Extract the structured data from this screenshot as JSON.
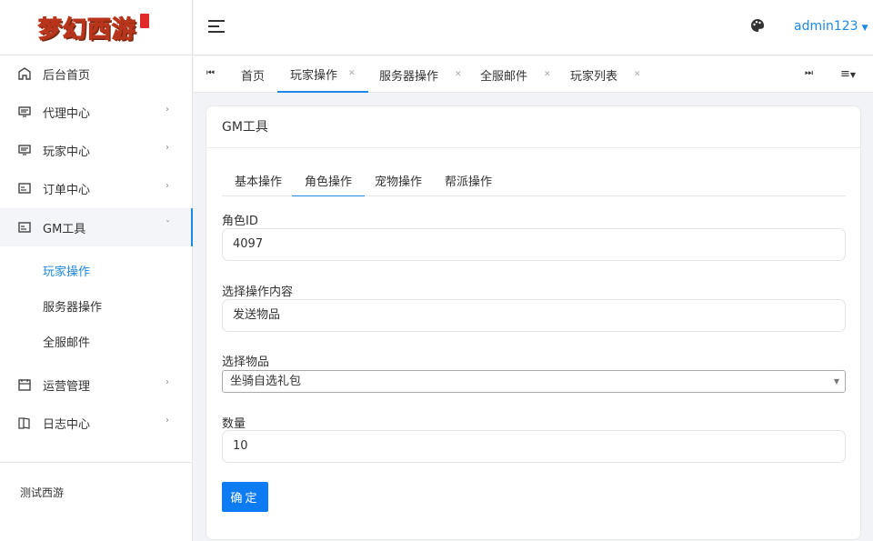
{
  "logo": {
    "text": "梦幻西游"
  },
  "sidebar": {
    "items": [
      {
        "label": "后台首页",
        "icon": "home-icon"
      },
      {
        "label": "代理中心",
        "icon": "monitor-icon"
      },
      {
        "label": "玩家中心",
        "icon": "monitor-icon"
      },
      {
        "label": "订单中心",
        "icon": "card-icon"
      },
      {
        "label": "GM工具",
        "icon": "card-icon"
      },
      {
        "label": "运营管理",
        "icon": "calendar-icon"
      },
      {
        "label": "日志中心",
        "icon": "book-icon"
      }
    ],
    "sub_items": [
      {
        "label": "玩家操作"
      },
      {
        "label": "服务器操作"
      },
      {
        "label": "全服邮件"
      }
    ],
    "footer": "测试西游"
  },
  "header": {
    "user": "admin123",
    "icons": [
      "menu-icon",
      "palette-icon"
    ]
  },
  "tabs": [
    {
      "label": "首页"
    },
    {
      "label": "玩家操作"
    },
    {
      "label": "服务器操作"
    },
    {
      "label": "全服邮件"
    },
    {
      "label": "玩家列表"
    }
  ],
  "card": {
    "title": "GM工具",
    "inner_tabs": [
      {
        "label": "基本操作"
      },
      {
        "label": "角色操作"
      },
      {
        "label": "宠物操作"
      },
      {
        "label": "帮派操作"
      }
    ],
    "fields": {
      "role_id": {
        "label": "角色ID",
        "value": "4097"
      },
      "operation": {
        "label": "选择操作内容",
        "value": "发送物品"
      },
      "item": {
        "label": "选择物品",
        "value": "坐骑自选礼包"
      },
      "quantity": {
        "label": "数量",
        "value": "10"
      }
    },
    "confirm_label": "确定"
  },
  "colors": {
    "accent": "#1e88e5",
    "button": "#0d7bf2"
  }
}
